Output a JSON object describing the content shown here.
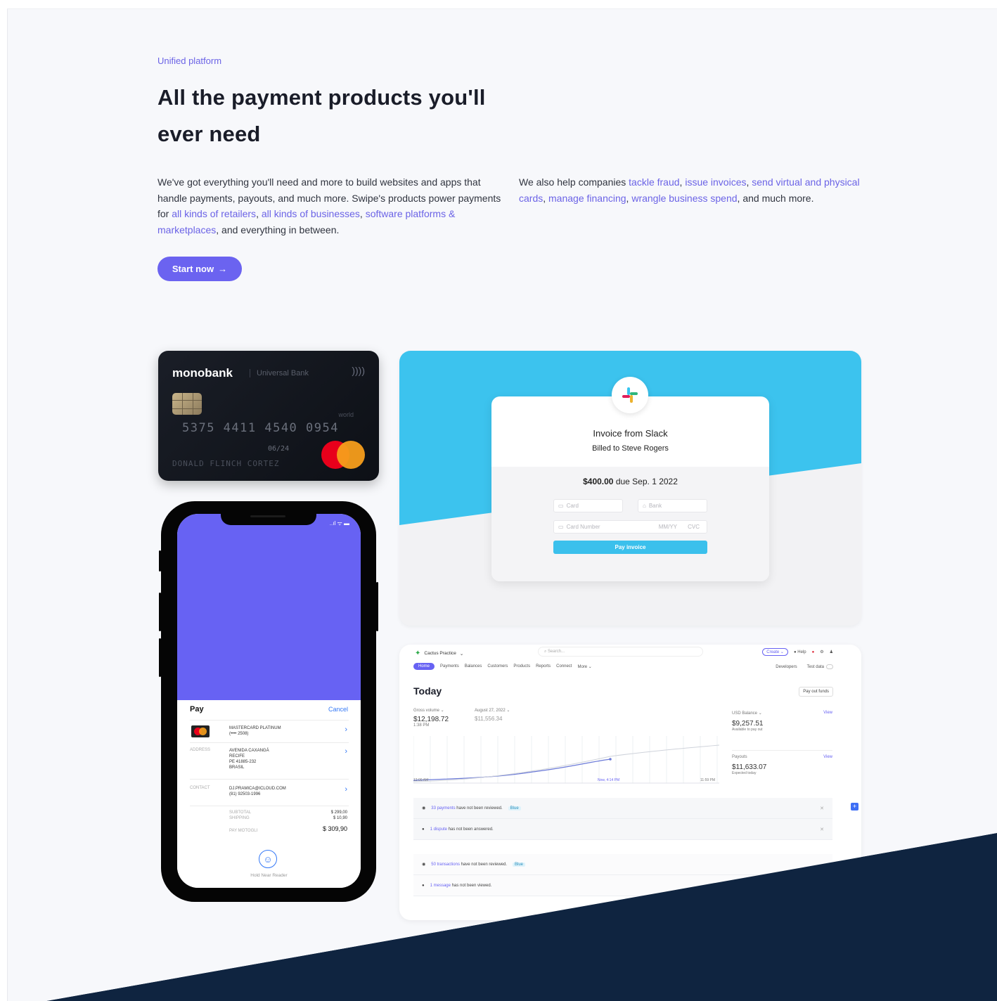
{
  "hero": {
    "eyebrow": "Unified platform",
    "headline": "All the payment products you'll ever need",
    "col1": {
      "t1": "We've got everything you'll need and more to build websites and apps that handle payments, payouts, and much more. Swipe's products power payments for ",
      "l1": "all kinds of retailers",
      "t2": ", ",
      "l2": "all kinds of businesses",
      "t3": ", ",
      "l3": "software platforms & marketplaces",
      "t4": ", and everything in between."
    },
    "col2": {
      "t1": "We also help companies ",
      "l1": "tackle fraud",
      "t2": ", ",
      "l2": "issue invoices",
      "t3": ", ",
      "l3": "send virtual and physical cards",
      "t4": ", ",
      "l4": "manage financing",
      "t5": ", ",
      "l5": "wrangle business spend",
      "t6": ", and much more."
    },
    "cta": "Start now",
    "cta_arrow": "→"
  },
  "colors": {
    "accent": "#6b63f0",
    "navy": "#0f2440",
    "sky": "#3cc3ee"
  },
  "card": {
    "brand": "monobank",
    "bank": "Universal Bank",
    "nfc": "))))",
    "world": "world",
    "number": "5375 4411 4540 0954",
    "expiry": "06/24",
    "holder": "DONALD FLINCH CORTEZ"
  },
  "phone": {
    "status": "..ıl ᯤ ▬",
    "pay_title": " Pay",
    "cancel": "Cancel",
    "card_name": "MASTERCARD PLATINUM",
    "card_digits": "(•••• 2508)",
    "address_label": "ADDRESS",
    "address_lines": [
      "AVENIDA CAXANGÁ",
      "RECIFE",
      "PE 41885-232",
      "BRASIL"
    ],
    "contact_label": "CONTACT",
    "contact_lines": [
      "DJ.PRAMICA@ICLOUD.COM",
      "(81) 92503-1996"
    ],
    "subtotal_label": "SUBTOTAL",
    "shipping_label": "SHIPPING",
    "subtotal": "$ 299,00",
    "shipping": "$ 10,90",
    "total_label": "PAY MOTOGLI",
    "total": "$ 309,90",
    "hold": "Hold Near Reader"
  },
  "invoice": {
    "title": "Invoice from Slack",
    "billed": "Billed to Steve Rogers",
    "amount": "$400.00",
    "due": " due Sep. 1 2022",
    "card_tab": "Card",
    "bank_tab": "Bank",
    "card_number": "Card Number",
    "mmyy": "MM/YY",
    "cvc": "CVC",
    "pay": "Pay invoice"
  },
  "dashboard": {
    "account": "Cactus Practice",
    "search": "Search...",
    "create": "Create",
    "help": "Help",
    "nav": [
      "Home",
      "Payments",
      "Balances",
      "Customers",
      "Products",
      "Reports",
      "Connect",
      "More"
    ],
    "developers": "Developers",
    "test_data": "Test data",
    "today": "Today",
    "payout_btn": "Pay out funds",
    "gross_label": "Gross volume",
    "gross": "$12,198.72",
    "gross_time": "1:38 PM",
    "date_label": "August 27, 2022",
    "prev": "$11,556.34",
    "x_start": "12:00 AM",
    "x_now": "Now, 4:14 PM",
    "x_end": "11:59 PM",
    "usd_label": "USD Balance",
    "usd": "$9,257.51",
    "usd_sub": "Available to pay out",
    "payouts_label": "Payouts",
    "payouts": "$11,633.07",
    "payouts_sub": "Expected today",
    "view": "View",
    "a1_link": "33 payments",
    "a1_text": " have not been reviewed.",
    "a2_link": "1 dispute",
    "a2_text": " has not been answered.",
    "a3_link": "50 transactions",
    "a3_text": " have not been reviewed.",
    "a4_link": "1 message",
    "a4_text": " has not been viewed.",
    "tag": "Blue"
  }
}
